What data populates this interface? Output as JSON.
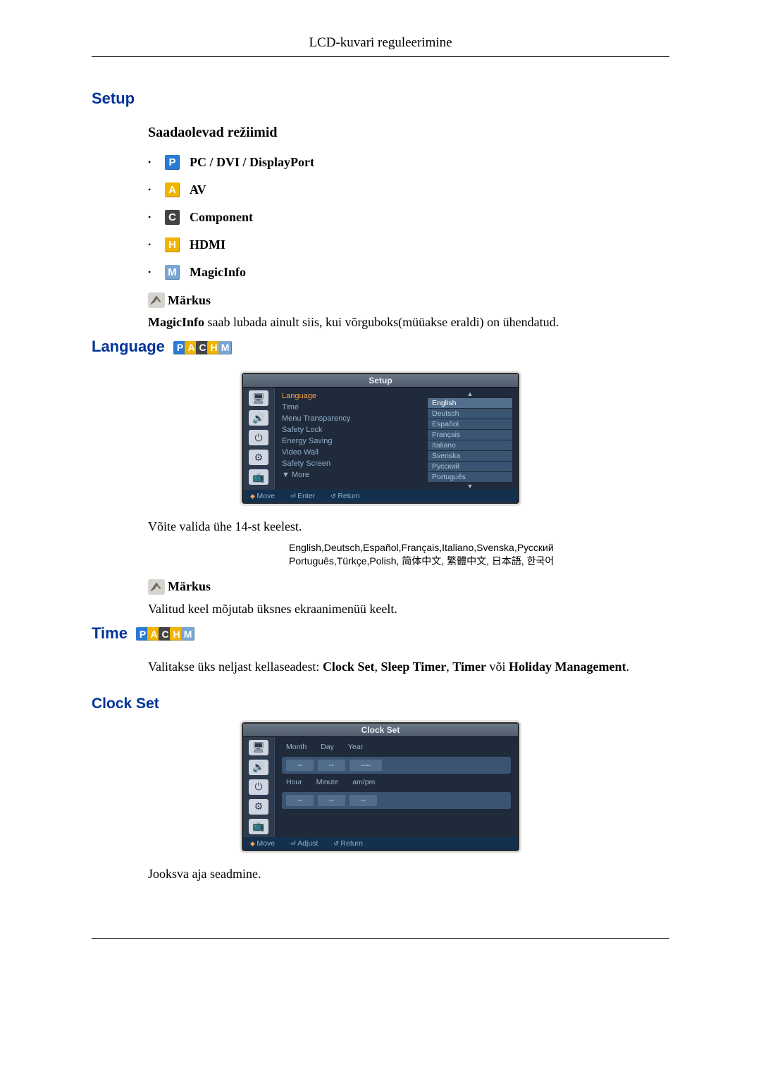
{
  "running_head": "LCD-kuvari reguleerimine",
  "setup": {
    "title": "Setup",
    "modes_heading": "Saadaolevad režiimid",
    "modes": {
      "pc": "PC / DVI / DisplayPort",
      "av": "AV",
      "component": "Component",
      "hdmi": "HDMI",
      "magicinfo": "MagicInfo"
    },
    "note_label": "Märkus",
    "note_text_prefix": "MagicInfo",
    "note_text_rest": " saab lubada ainult siis, kui võrguboks(müüakse eraldi) on ühendatud."
  },
  "language": {
    "title": "Language",
    "osd": {
      "title": "Setup",
      "items": [
        "Language",
        "Time",
        "Menu Transparency",
        "Safety Lock",
        "Energy Saving",
        "Video Wall",
        "Safety Screen",
        "▼ More"
      ],
      "values": [
        "English",
        "Deutsch",
        "Español",
        "Français",
        "Italiano",
        "Svenska",
        "Русский",
        "Português"
      ],
      "foot_move": "Move",
      "foot_enter": "Enter",
      "foot_return": "Return"
    },
    "body1": "Võite valida ühe 14-st keelest.",
    "lang_list_line1": "English,Deutsch,Español,Français,Italiano,Svenska,Русский",
    "lang_list_line2": "Português,Türkçe,Polish, 简体中文,  繁體中文, 日本語, 한국어",
    "note_label": "Märkus",
    "note_text": "Valitud keel mõjutab üksnes ekraanimenüü keelt."
  },
  "time": {
    "title": "Time",
    "body_prefix": "Valitakse üks neljast kellaseadest: ",
    "opt1": "Clock Set",
    "sep1": ", ",
    "opt2": "Sleep Timer",
    "sep2": ", ",
    "opt3": "Timer",
    "sep3": " või ",
    "opt4": "Holiday Management",
    "suffix": "."
  },
  "clockset": {
    "title": "Clock Set",
    "osd_title": "Clock Set",
    "labels": {
      "month": "Month",
      "day": "Day",
      "year": "Year",
      "hour": "Hour",
      "minute": "Minute",
      "ampm": "am/pm"
    },
    "foot_move": "Move",
    "foot_adjust": "Adjust",
    "foot_return": "Return",
    "body": "Jooksva aja seadmine."
  },
  "badge_letters": {
    "p": "P",
    "a": "A",
    "c": "C",
    "h": "H",
    "m": "M"
  }
}
